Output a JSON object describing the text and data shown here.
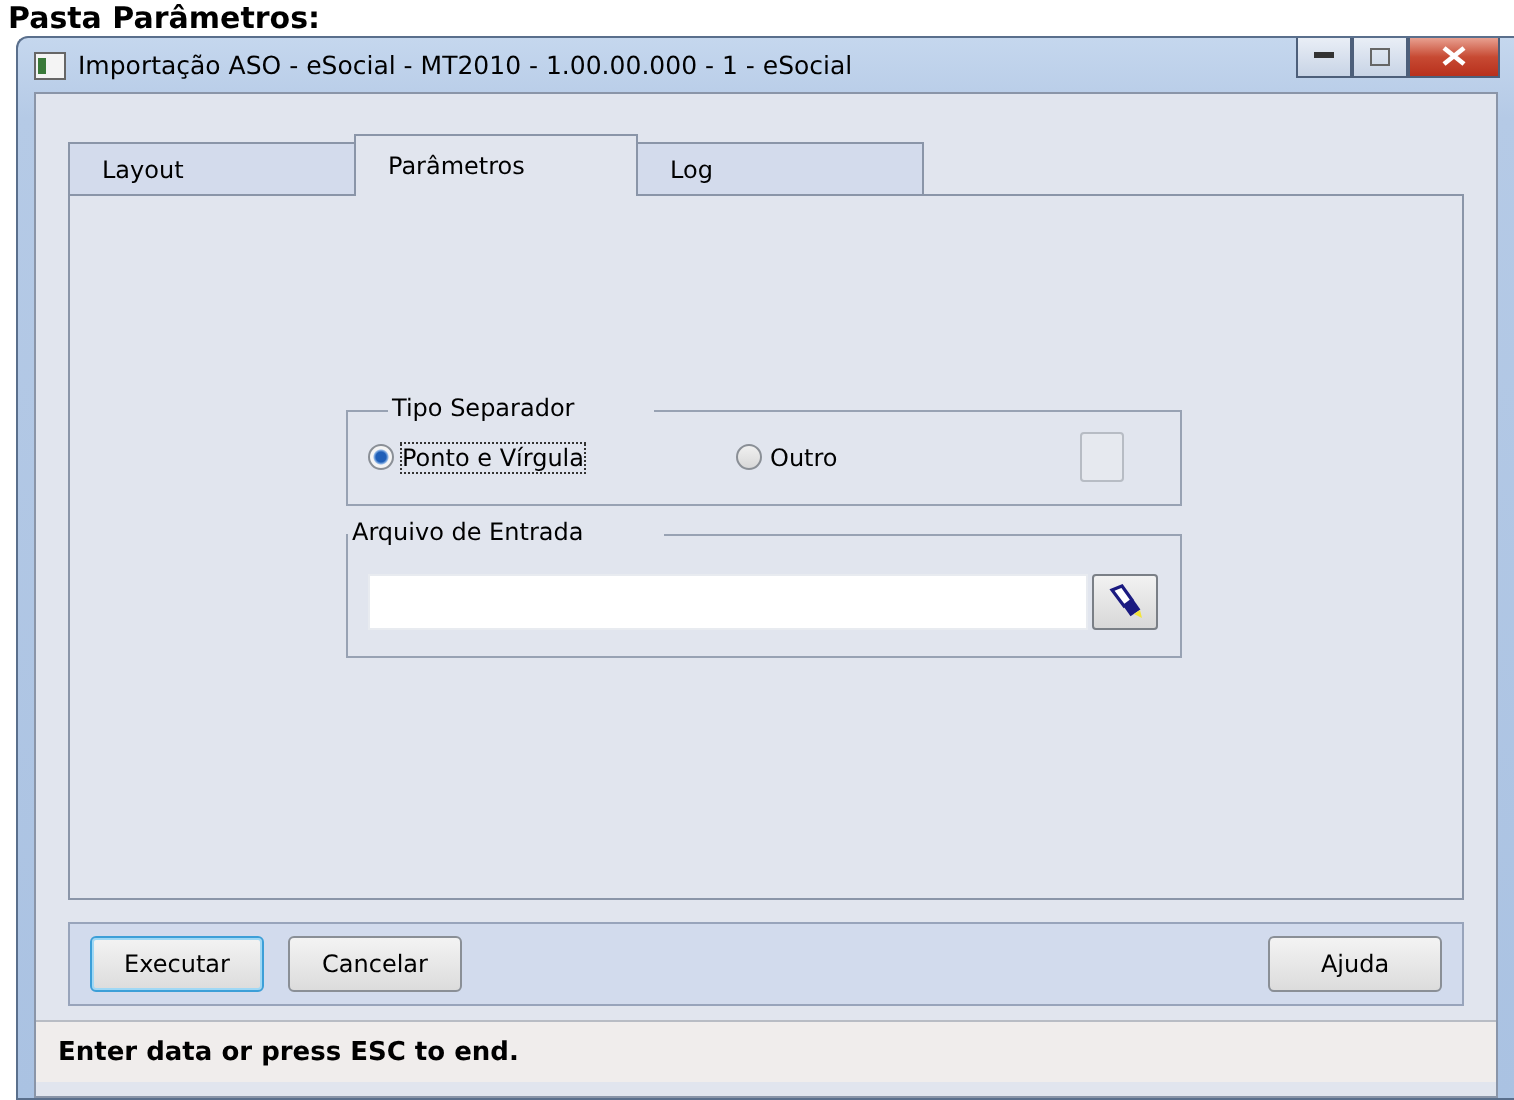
{
  "heading": "Pasta Parâmetros:",
  "window": {
    "title": "Importação ASO - eSocial - MT2010 - 1.00.00.000 - 1 - eSocial"
  },
  "tabs": [
    {
      "label": "Layout",
      "selected": false
    },
    {
      "label": "Parâmetros",
      "selected": true
    },
    {
      "label": "Log",
      "selected": false
    }
  ],
  "separator_group": {
    "title": "Tipo Separador",
    "options": [
      {
        "label": "Ponto e Vírgula",
        "selected": true
      },
      {
        "label": "Outro",
        "selected": false
      }
    ]
  },
  "input_file_group": {
    "title": "Arquivo de Entrada"
  },
  "buttons": [
    {
      "label": "Executar",
      "default": true
    },
    {
      "label": "Cancelar",
      "default": false
    },
    {
      "label": "Ajuda",
      "default": false
    }
  ],
  "status_bar": "Enter data or press ESC to end."
}
